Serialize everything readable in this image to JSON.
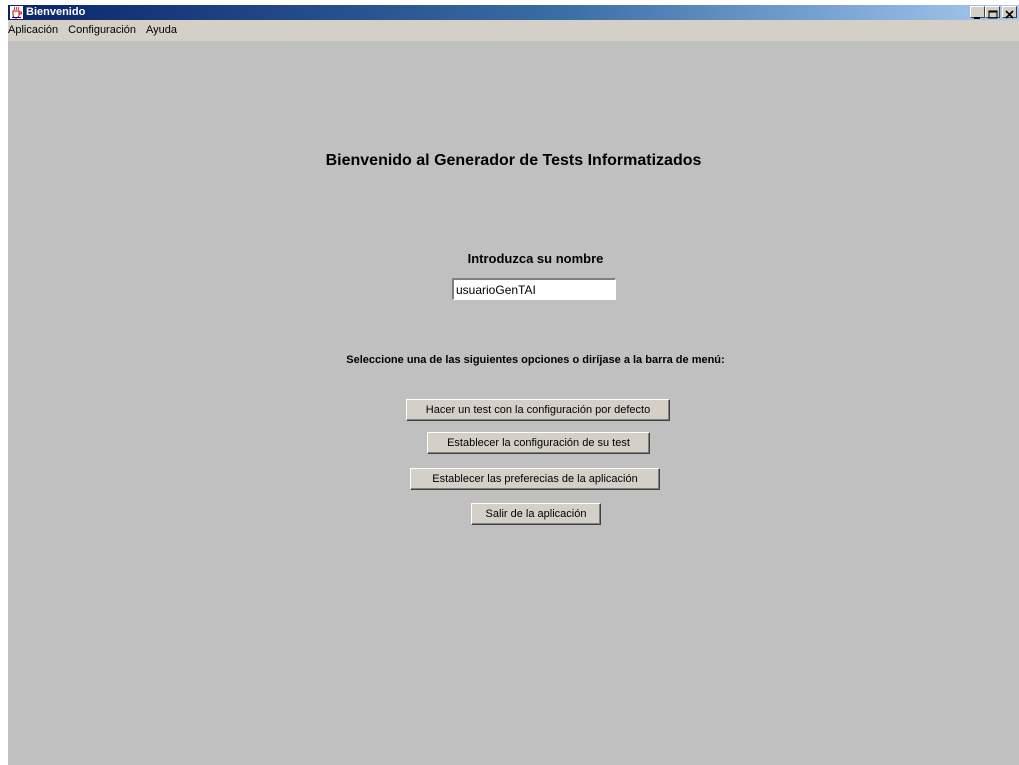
{
  "window": {
    "title": "Bienvenido",
    "icon": "java-coffee-cup-icon"
  },
  "menubar": {
    "items": [
      {
        "label": "Aplicación"
      },
      {
        "label": "Configuración"
      },
      {
        "label": "Ayuda"
      }
    ]
  },
  "main": {
    "welcome_title": "Bienvenido al Generador de Tests Informatizados",
    "name_label": "Introduzca su nombre",
    "name_value": "usuarioGenTAI",
    "options_label": "Seleccione una de las siguientes opciones o diríjase a la barra de menú:",
    "buttons": [
      {
        "label": "Hacer un test con la configuración por defecto"
      },
      {
        "label": "Establecer la configuración de su test"
      },
      {
        "label": "Establecer las preferecias de la aplicación"
      },
      {
        "label": "Salir de la aplicación"
      }
    ]
  },
  "colors": {
    "background": "#c0c0c0",
    "titlebar_start": "#0a246a",
    "titlebar_end": "#a6caf0",
    "menubar": "#d4d0c8"
  }
}
